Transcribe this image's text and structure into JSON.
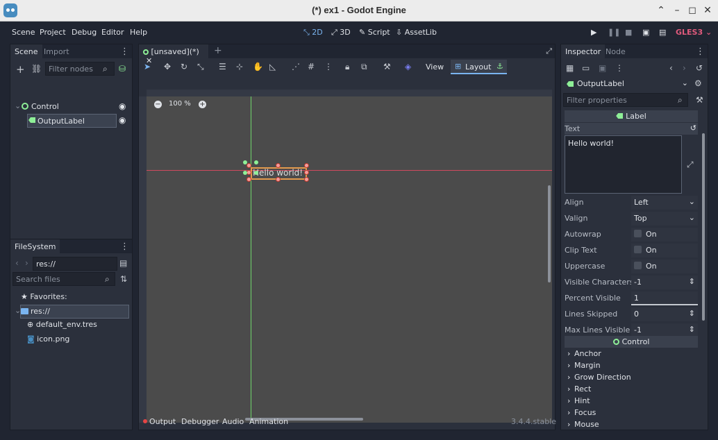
{
  "window": {
    "title": "(*) ex1 - Godot Engine"
  },
  "menu": [
    "Scene",
    "Project",
    "Debug",
    "Editor",
    "Help"
  ],
  "workspaces": {
    "two_d": "2D",
    "three_d": "3D",
    "script": "Script",
    "assetlib": "AssetLib"
  },
  "renderer": "GLES3",
  "scene_dock": {
    "tabs": [
      "Scene",
      "Import"
    ],
    "filter_placeholder": "Filter nodes",
    "nodes": [
      {
        "name": "Control"
      },
      {
        "name": "OutputLabel"
      }
    ]
  },
  "filesystem_dock": {
    "tab": "FileSystem",
    "path": "res://",
    "search_placeholder": "Search files",
    "favorites": "Favorites:",
    "root": "res://",
    "files": [
      "default_env.tres",
      "icon.png"
    ]
  },
  "editor": {
    "scene_tab": "[unsaved](*)",
    "view_label": "View",
    "layout_label": "Layout",
    "zoom": "100 %",
    "label_text": "Hello world!"
  },
  "bottom_panel": {
    "tabs": [
      "Output",
      "Debugger",
      "Audio",
      "Animation"
    ],
    "version": "3.4.4.stable"
  },
  "inspector": {
    "tabs": [
      "Inspector",
      "Node"
    ],
    "object": "OutputLabel",
    "filter_placeholder": "Filter properties",
    "label_section": "Label",
    "text_label": "Text",
    "text_value": "Hello world!",
    "props": [
      {
        "label": "Align",
        "value": "Left",
        "kind": "select"
      },
      {
        "label": "Valign",
        "value": "Top",
        "kind": "select"
      },
      {
        "label": "Autowrap",
        "value": "On",
        "kind": "check"
      },
      {
        "label": "Clip Text",
        "value": "On",
        "kind": "check"
      },
      {
        "label": "Uppercase",
        "value": "On",
        "kind": "check"
      },
      {
        "label": "Visible Characters",
        "value": "-1",
        "kind": "spin"
      },
      {
        "label": "Percent Visible",
        "value": "1",
        "kind": "slider"
      },
      {
        "label": "Lines Skipped",
        "value": "0",
        "kind": "spin"
      },
      {
        "label": "Max Lines Visible",
        "value": "-1",
        "kind": "spin"
      }
    ],
    "control_section": "Control",
    "control_groups": [
      "Anchor",
      "Margin",
      "Grow Direction",
      "Rect",
      "Hint",
      "Focus",
      "Mouse"
    ]
  },
  "colors": {
    "accent": "#7ab4f0",
    "label_green": "#8eef97",
    "gles": "#e05a7c"
  }
}
